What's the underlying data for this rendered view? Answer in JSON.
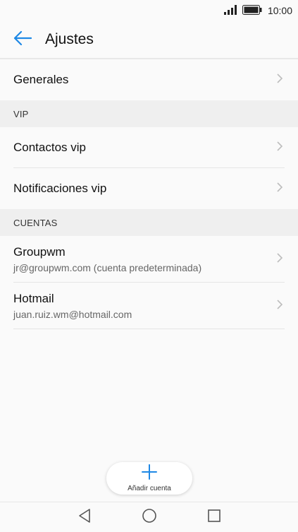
{
  "status_bar": {
    "time": "10:00",
    "icons": [
      "signal-icon",
      "battery-icon"
    ]
  },
  "app_bar": {
    "title": "Ajustes",
    "back_icon": "back-arrow-icon",
    "accent_color": "#1e88e5"
  },
  "rows": {
    "general": {
      "label": "Generales"
    }
  },
  "sections": {
    "vip": {
      "header": "VIP",
      "items": [
        {
          "label": "Contactos vip"
        },
        {
          "label": "Notificaciones vip"
        }
      ]
    },
    "accounts": {
      "header": "CUENTAS",
      "items": [
        {
          "label": "Groupwm",
          "sublabel": "jr@groupwm.com (cuenta predeterminada)"
        },
        {
          "label": "Hotmail",
          "sublabel": "juan.ruiz.wm@hotmail.com"
        }
      ]
    }
  },
  "fab": {
    "label": "Añadir cuenta",
    "icon": "plus-icon"
  },
  "nav_bar": {
    "icons": [
      "back-triangle-icon",
      "home-circle-icon",
      "recents-square-icon"
    ]
  }
}
